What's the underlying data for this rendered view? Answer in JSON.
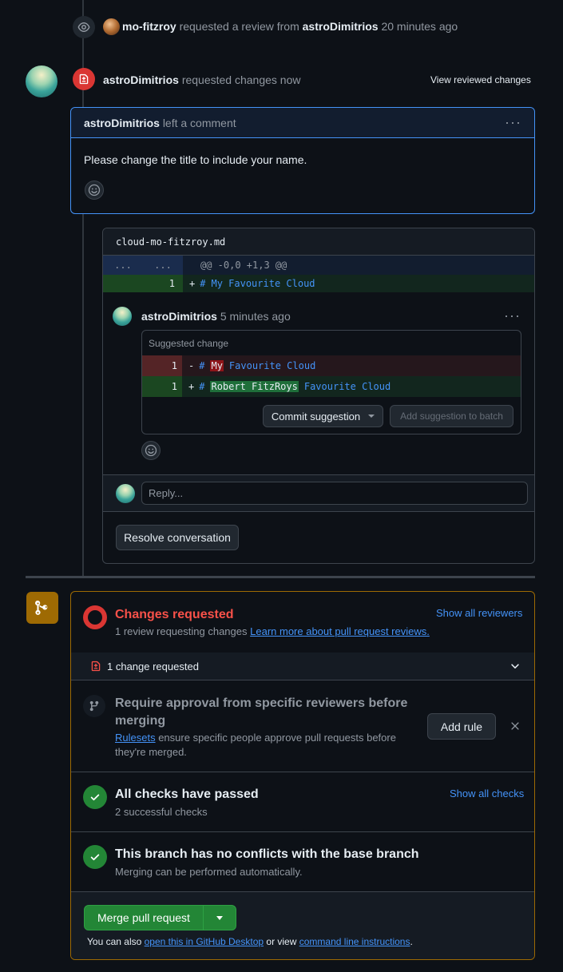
{
  "event": {
    "actor": "mo-fitzroy",
    "action": "requested a review from",
    "target": "astroDimitrios",
    "time": "20 minutes ago"
  },
  "review": {
    "author": "astroDimitrios",
    "action": "requested changes now",
    "view_link": "View reviewed changes",
    "comment_header_author": "astroDimitrios",
    "comment_header_action": "left a comment",
    "comment_body": "Please change the title to include your name.",
    "menu_glyph": "···"
  },
  "thread": {
    "filename": "cloud-mo-fitzroy.md",
    "hunk_nums_left": "...",
    "hunk_nums_right": "...",
    "hunk_header": "@@ -0,0 +1,3 @@",
    "added_line_num": "1",
    "added_marker": "+",
    "added_hash": "#",
    "added_text": "My Favourite Cloud",
    "comment_author": "astroDimitrios",
    "comment_time": "5 minutes ago",
    "suggested_label": "Suggested change",
    "del_num": "1",
    "del_marker": "-",
    "del_hash": "#",
    "del_highlight": "My",
    "del_rest": "Favourite Cloud",
    "add_num": "1",
    "add_marker": "+",
    "add_hash": "#",
    "add_highlight": "Robert FitzRoys",
    "add_rest": "Favourite Cloud",
    "commit_button": "Commit suggestion",
    "batch_button": "Add suggestion to batch",
    "reply_placeholder": "Reply...",
    "resolve_button": "Resolve conversation"
  },
  "merge": {
    "status_title": "Changes requested",
    "status_sub": "1 review requesting changes",
    "status_link": "Learn more about pull request reviews.",
    "show_reviewers": "Show all reviewers",
    "change_requested_row": "1 change requested",
    "ruleset_title": "Require approval from specific reviewers before merging",
    "ruleset_link": "Rulesets",
    "ruleset_text": "ensure specific people approve pull requests before they're merged.",
    "add_rule": "Add rule",
    "checks_title": "All checks have passed",
    "checks_sub": "2 successful checks",
    "show_checks": "Show all checks",
    "conflicts_title": "This branch has no conflicts with the base branch",
    "conflicts_sub": "Merging can be performed automatically.",
    "merge_button": "Merge pull request",
    "footer_prefix": "You can also",
    "footer_link1": "open this in GitHub Desktop",
    "footer_mid": "or view",
    "footer_link2": "command line instructions",
    "footer_end": "."
  },
  "colors": {
    "accent": "#4493f8",
    "danger": "#da3633",
    "success": "#238636",
    "attention": "#9e6a03"
  }
}
